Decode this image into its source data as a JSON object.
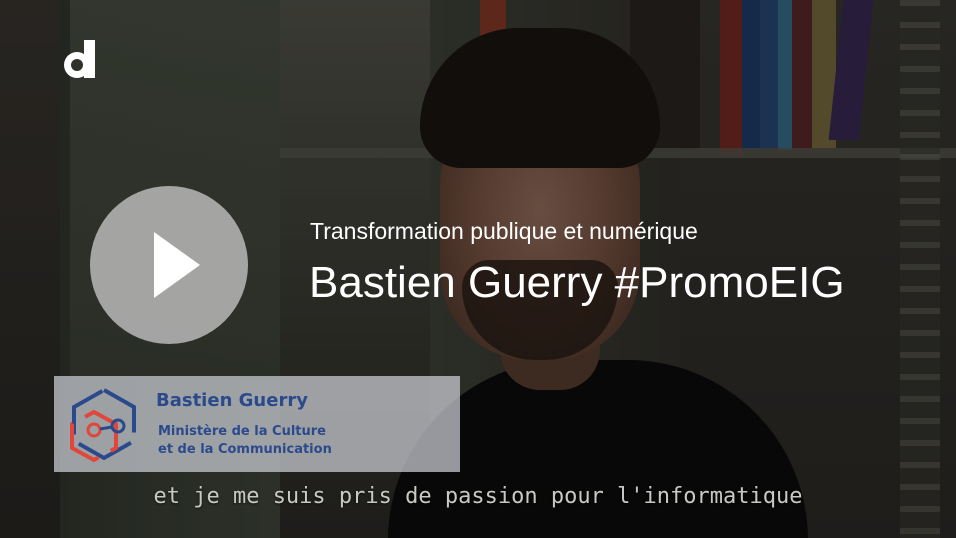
{
  "player": {
    "brand_icon": "dailymotion-logo-icon",
    "play_icon": "play-icon",
    "video_category": "Transformation publique et numérique",
    "video_title": "Bastien Guerry #PromoEIG"
  },
  "lower_third": {
    "logo_icon": "hexagon-network-logo-icon",
    "name": "Bastien Guerry",
    "org_line1": "Ministère de la Culture",
    "org_line2": "et de la Communication"
  },
  "caption": {
    "text": "et je me suis pris de passion pour l'informatique"
  },
  "colors": {
    "lower_third_text": "#2b4a8c",
    "logo_blue": "#2b4a8c",
    "logo_red": "#e0473a",
    "play_button_bg": "#bebebe",
    "title_text": "#ffffff"
  }
}
